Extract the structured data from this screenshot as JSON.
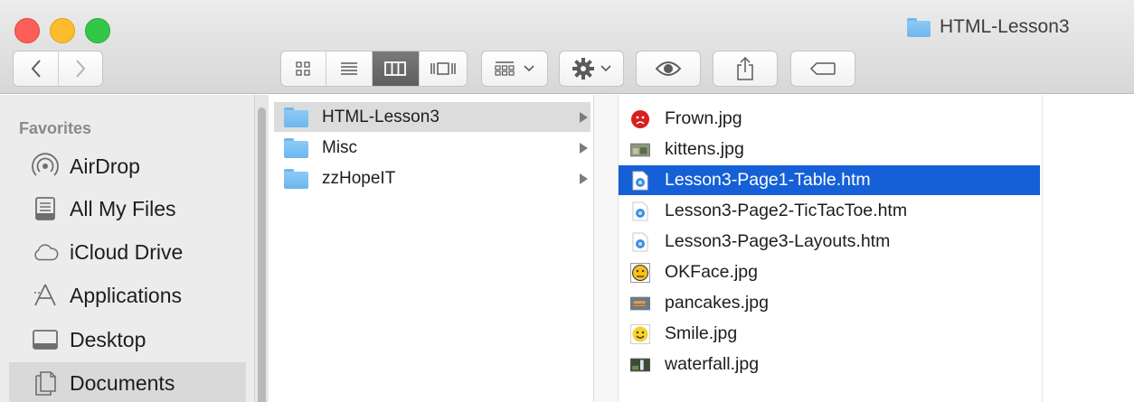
{
  "window": {
    "title": "HTML-Lesson3",
    "colors": {
      "selection": "#1560d6",
      "folder": "#7cc0f3",
      "close": "#fc5f57",
      "minimize": "#fdbc2e",
      "zoom": "#33c748"
    }
  },
  "toolbar": {
    "back_icon": "chevron-left-icon",
    "forward_icon": "chevron-right-icon",
    "view_modes": [
      "icon-view-icon",
      "list-view-icon",
      "column-view-icon",
      "cover-flow-icon"
    ],
    "active_view": "column-view-icon",
    "arrange_icon": "arrange-grid-icon",
    "action_icon": "gear-icon",
    "quicklook_icon": "eye-icon",
    "share_icon": "share-icon",
    "tag_icon": "tag-icon"
  },
  "sidebar": {
    "section": "Favorites",
    "items": [
      {
        "label": "AirDrop",
        "icon": "airdrop-icon"
      },
      {
        "label": "All My Files",
        "icon": "all-files-icon"
      },
      {
        "label": "iCloud Drive",
        "icon": "cloud-icon"
      },
      {
        "label": "Applications",
        "icon": "applications-icon"
      },
      {
        "label": "Desktop",
        "icon": "desktop-icon"
      },
      {
        "label": "Documents",
        "icon": "documents-icon",
        "selected": true
      }
    ]
  },
  "column1": {
    "items": [
      {
        "label": "HTML-Lesson3",
        "selected": true
      },
      {
        "label": "Misc"
      },
      {
        "label": "zzHopeIT"
      }
    ]
  },
  "column2": {
    "items": [
      {
        "label": "Frown.jpg",
        "icon": "frown-image-icon"
      },
      {
        "label": "kittens.jpg",
        "icon": "image-thumbnail-icon"
      },
      {
        "label": "Lesson3-Page1-Table.htm",
        "icon": "html-file-icon",
        "selected": true
      },
      {
        "label": "Lesson3-Page2-TicTacToe.htm",
        "icon": "html-file-icon"
      },
      {
        "label": "Lesson3-Page3-Layouts.htm",
        "icon": "html-file-icon"
      },
      {
        "label": "OKFace.jpg",
        "icon": "okface-image-icon"
      },
      {
        "label": "pancakes.jpg",
        "icon": "image-thumbnail-icon"
      },
      {
        "label": "Smile.jpg",
        "icon": "smile-image-icon"
      },
      {
        "label": "waterfall.jpg",
        "icon": "image-thumbnail-icon"
      }
    ]
  }
}
